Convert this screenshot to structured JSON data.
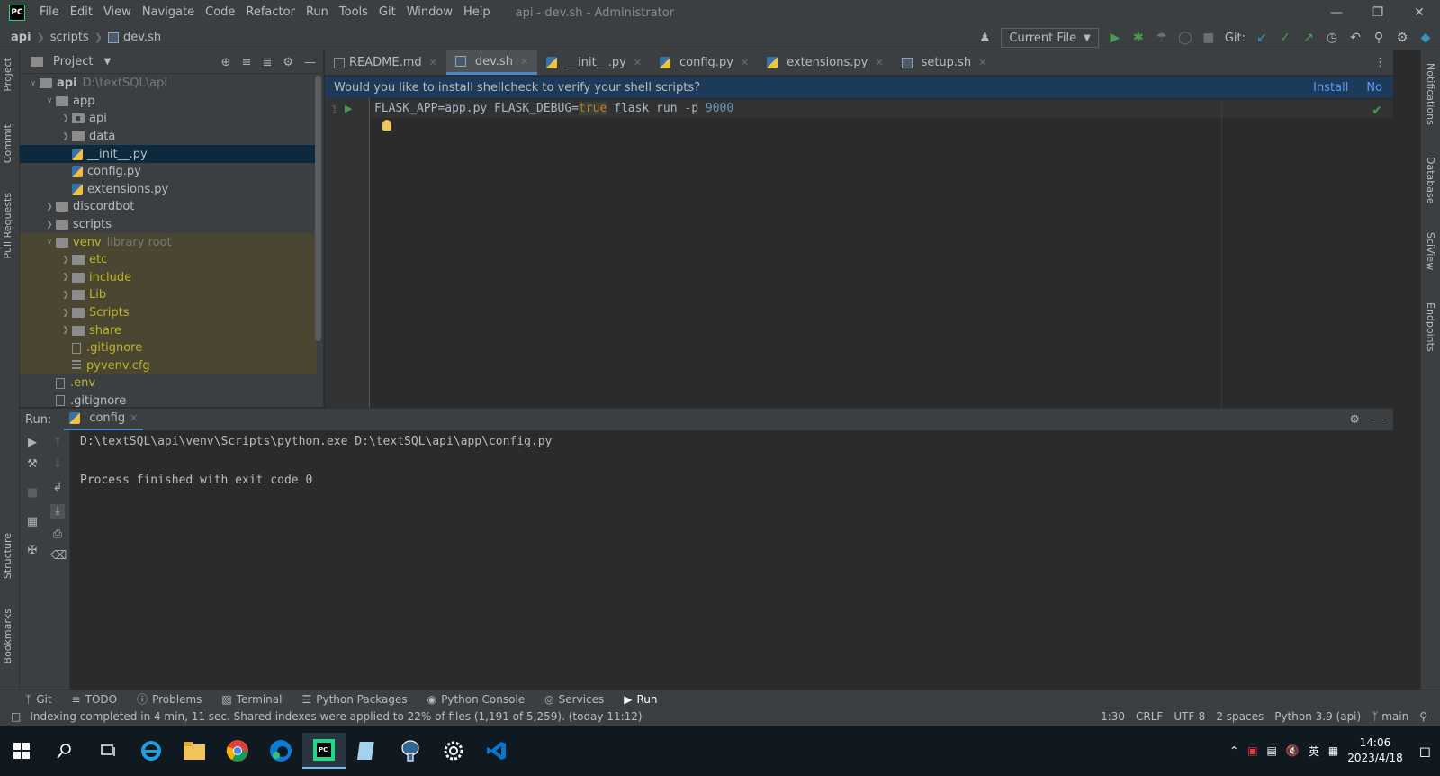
{
  "window": {
    "title": "api - dev.sh - Administrator",
    "menu": [
      "File",
      "Edit",
      "View",
      "Navigate",
      "Code",
      "Refactor",
      "Run",
      "Tools",
      "Git",
      "Window",
      "Help"
    ]
  },
  "breadcrumb": [
    "api",
    "scripts",
    "dev.sh"
  ],
  "toolbar": {
    "run_config": "Current File",
    "git_label": "Git:"
  },
  "project": {
    "title": "Project",
    "tree": [
      {
        "label": "api",
        "suffix": "D:\\textSQL\\api",
        "depth": 0,
        "kind": "folder",
        "open": true
      },
      {
        "label": "app",
        "depth": 1,
        "kind": "folder",
        "open": true
      },
      {
        "label": "api",
        "depth": 2,
        "kind": "pkg",
        "open": false
      },
      {
        "label": "data",
        "depth": 2,
        "kind": "folder",
        "open": false
      },
      {
        "label": "__init__.py",
        "depth": 2,
        "kind": "py",
        "selected": true
      },
      {
        "label": "config.py",
        "depth": 2,
        "kind": "py"
      },
      {
        "label": "extensions.py",
        "depth": 2,
        "kind": "py"
      },
      {
        "label": "discordbot",
        "depth": 1,
        "kind": "folder",
        "open": false
      },
      {
        "label": "scripts",
        "depth": 1,
        "kind": "folder",
        "open": false
      },
      {
        "label": "venv",
        "suffix": "library root",
        "depth": 1,
        "kind": "folder",
        "open": true,
        "lib": true
      },
      {
        "label": "etc",
        "depth": 2,
        "kind": "folder",
        "open": false,
        "lib": true
      },
      {
        "label": "include",
        "depth": 2,
        "kind": "folder",
        "open": false,
        "lib": true
      },
      {
        "label": "Lib",
        "depth": 2,
        "kind": "folder",
        "open": false,
        "lib": true
      },
      {
        "label": "Scripts",
        "depth": 2,
        "kind": "folder",
        "open": false,
        "lib": true
      },
      {
        "label": "share",
        "depth": 2,
        "kind": "folder",
        "open": false,
        "lib": true
      },
      {
        "label": ".gitignore",
        "depth": 2,
        "kind": "txt",
        "lib": true
      },
      {
        "label": "pyvenv.cfg",
        "depth": 2,
        "kind": "cfg",
        "lib": true
      },
      {
        "label": ".env",
        "depth": 1,
        "kind": "txt",
        "env": true
      },
      {
        "label": ".gitignore",
        "depth": 1,
        "kind": "txt"
      }
    ]
  },
  "editor": {
    "tabs": [
      {
        "label": "README.md",
        "icon": "md"
      },
      {
        "label": "dev.sh",
        "icon": "sh",
        "active": true
      },
      {
        "label": "__init__.py",
        "icon": "py"
      },
      {
        "label": "config.py",
        "icon": "py"
      },
      {
        "label": "extensions.py",
        "icon": "py"
      },
      {
        "label": "setup.sh",
        "icon": "sh"
      }
    ],
    "banner": {
      "text": "Would you like to install shellcheck to verify your shell scripts?",
      "install": "Install",
      "no": "No"
    },
    "line_number": "1",
    "code": {
      "part1": "FLASK_APP=app.py FLASK_DEBUG=",
      "kw": "true",
      "part2": " flask run -p ",
      "num": "9000"
    }
  },
  "run": {
    "label": "Run:",
    "tab": "config",
    "lines": [
      "D:\\textSQL\\api\\venv\\Scripts\\python.exe D:\\textSQL\\api\\app\\config.py",
      "",
      "Process finished with exit code 0"
    ]
  },
  "left_stripe": [
    "Project",
    "Commit",
    "Pull Requests",
    "Structure",
    "Bookmarks"
  ],
  "right_stripe": [
    "Notifications",
    "Database",
    "SciView",
    "Endpoints"
  ],
  "bottom_tools": [
    "Git",
    "TODO",
    "Problems",
    "Terminal",
    "Python Packages",
    "Python Console",
    "Services",
    "Run"
  ],
  "status": {
    "message": "Indexing completed in 4 min, 11 sec. Shared indexes were applied to 22% of files (1,191 of 5,259). (today 11:12)",
    "position": "1:30",
    "line_sep": "CRLF",
    "encoding": "UTF-8",
    "indent": "2 spaces",
    "interpreter": "Python 3.9 (api)",
    "branch": "main"
  },
  "taskbar": {
    "time": "14:06",
    "date": "2023/4/18",
    "ime": "英"
  }
}
